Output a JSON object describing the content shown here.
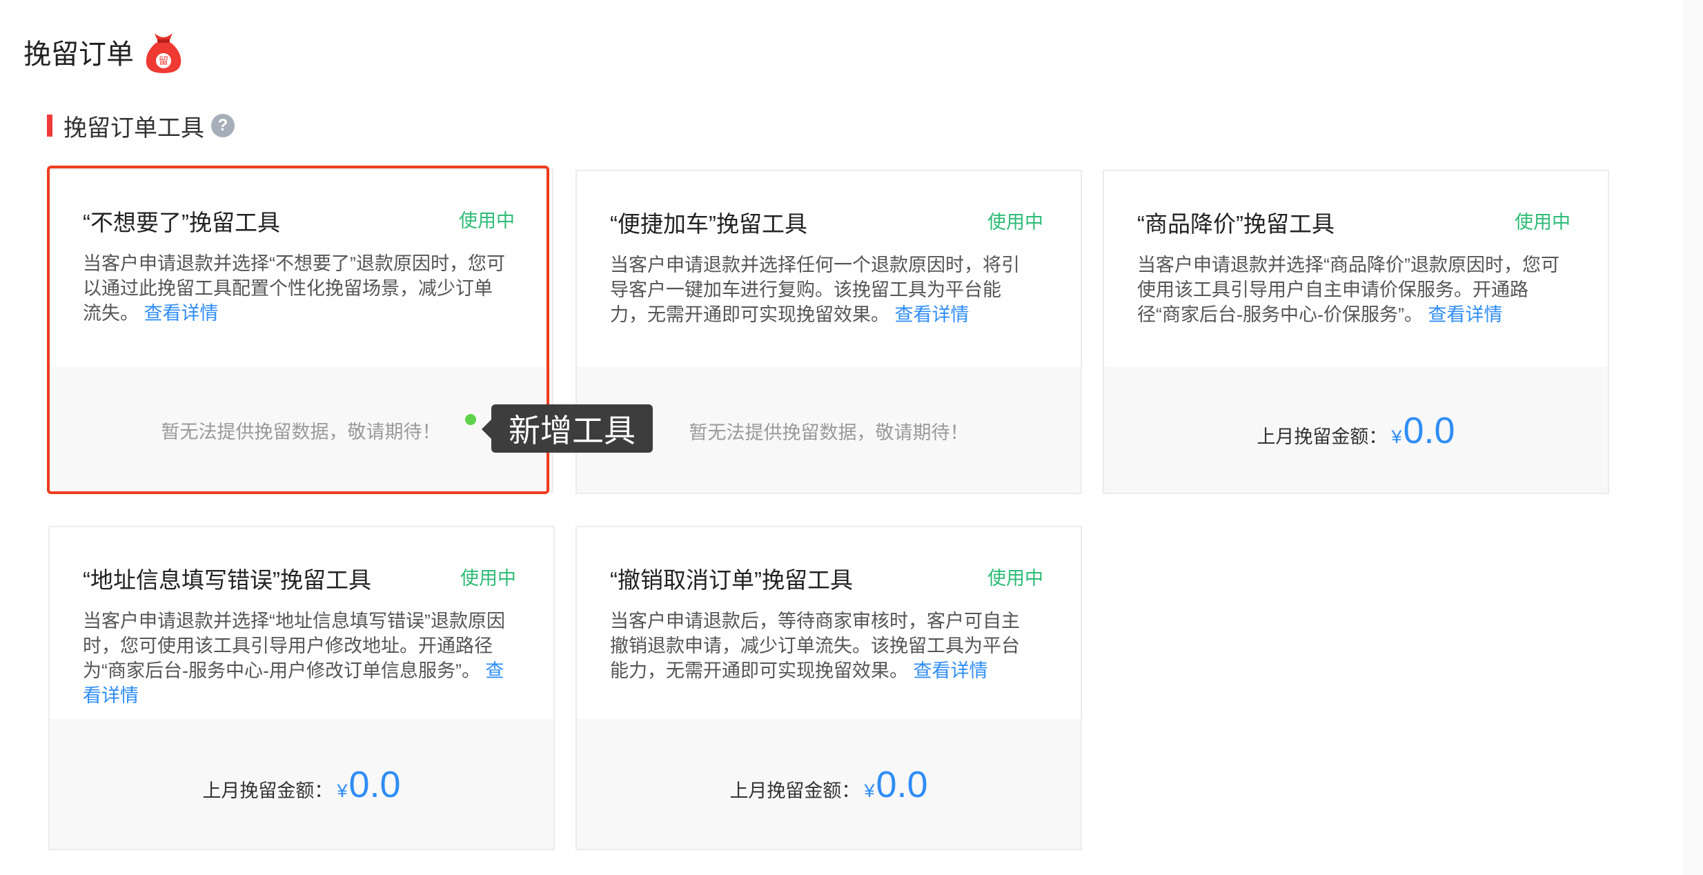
{
  "page": {
    "title": "挽留订单"
  },
  "section": {
    "title": "挽留订单工具",
    "help_glyph": "?"
  },
  "tooltip": {
    "text": "新增工具"
  },
  "colors": {
    "accent": "#2e8df5",
    "status_green": "#2ebc77",
    "section_bar": "#f03a3a",
    "highlight_border": "#ee3b1c",
    "tooltip_bg": "#3d3d3d"
  },
  "cards": [
    {
      "title": "“不想要了”挽留工具",
      "status": "使用中",
      "description": "当客户申请退款并选择“不想要了”退款原因时，您可以通过此挽留工具配置个性化挽留场景，减少订单流失。",
      "link": "查看详情",
      "no_data": "暂无法提供挽留数据，敬请期待！"
    },
    {
      "title": "“便捷加车”挽留工具",
      "status": "使用中",
      "description": "当客户申请退款并选择任何一个退款原因时，将引导客户一键加车进行复购。该挽留工具为平台能力，无需开通即可实现挽留效果。",
      "link": "查看详情",
      "no_data": "暂无法提供挽留数据，敬请期待！"
    },
    {
      "title": "“商品降价”挽留工具",
      "status": "使用中",
      "description": "当客户申请退款并选择“商品降价”退款原因时，您可使用该工具引导用户自主申请价保服务。开通路径“商家后台-服务中心-价保服务”。",
      "link": "查看详情",
      "metric_label": "上月挽留金额：",
      "currency": "¥",
      "metric_value": "0.0"
    },
    {
      "title": "“地址信息填写错误”挽留工具",
      "status": "使用中",
      "description": "当客户申请退款并选择“地址信息填写错误”退款原因时，您可使用该工具引导用户修改地址。开通路径为“商家后台-服务中心-用户修改订单信息服务”。",
      "link": "查看详情",
      "metric_label": "上月挽留金额：",
      "currency": "¥",
      "metric_value": "0.0"
    },
    {
      "title": "“撤销取消订单”挽留工具",
      "status": "使用中",
      "description": "当客户申请退款后，等待商家审核时，客户可自主撤销退款申请，减少订单流失。该挽留工具为平台能力，无需开通即可实现挽留效果。",
      "link": "查看详情",
      "metric_label": "上月挽留金额：",
      "currency": "¥",
      "metric_value": "0.0"
    }
  ]
}
